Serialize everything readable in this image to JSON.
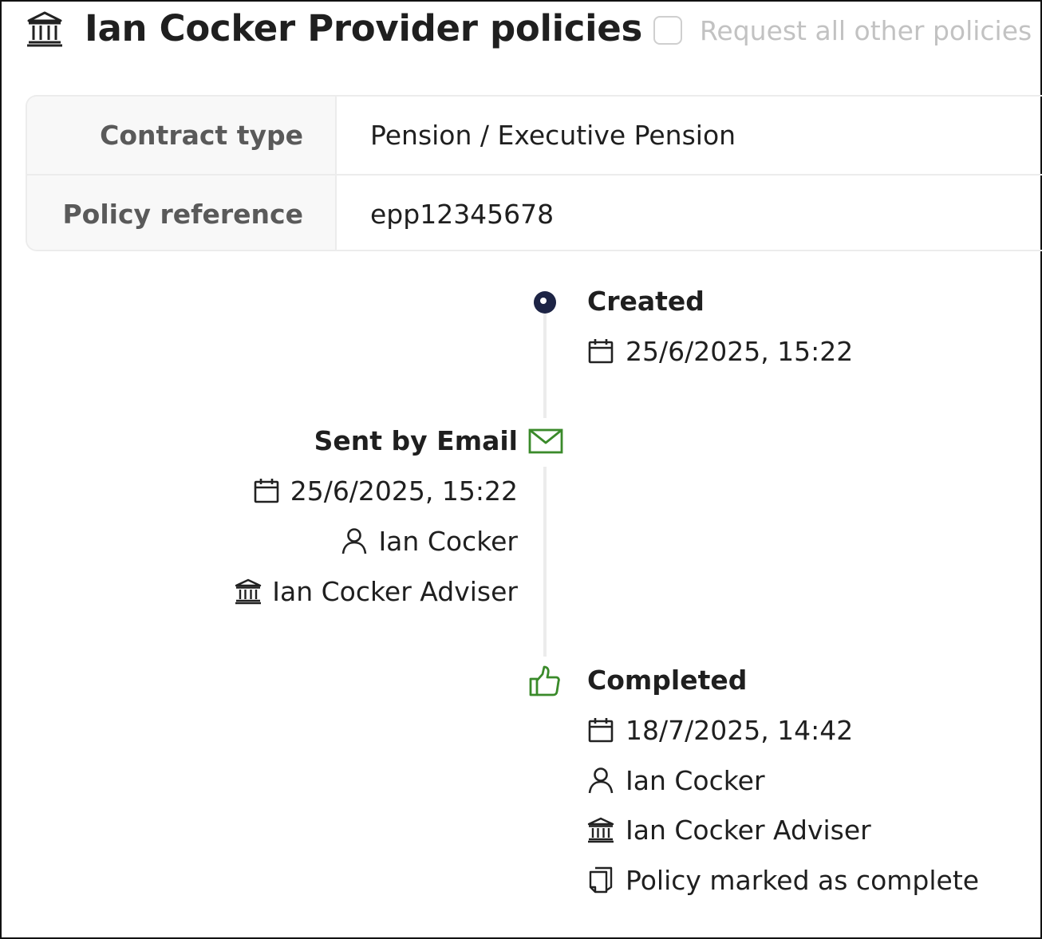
{
  "header": {
    "title": "Ian Cocker Provider policies",
    "request_all_label": "Request all other policies",
    "request_all_checked": false
  },
  "details": [
    {
      "label": "Contract type",
      "value": "Pension / Executive Pension"
    },
    {
      "label": "Policy reference",
      "value": "epp12345678"
    }
  ],
  "timeline": {
    "created": {
      "title": "Created",
      "date": "25/6/2025, 15:22"
    },
    "sent": {
      "title": "Sent by Email",
      "date": "25/6/2025, 15:22",
      "user": "Ian Cocker",
      "organisation": "Ian Cocker Adviser"
    },
    "completed": {
      "title": "Completed",
      "date": "18/7/2025, 14:42",
      "user": "Ian Cocker",
      "organisation": "Ian Cocker Adviser",
      "note": "Policy marked as complete"
    }
  },
  "colors": {
    "accent_green": "#3a8a2a",
    "marker_navy": "#1d2445",
    "line_grey": "#ececec"
  },
  "icons": {
    "title": "bank-icon",
    "created": "circle-dot-icon",
    "sent": "envelope-icon",
    "completed": "thumbs-up-icon",
    "date": "calendar-icon",
    "user": "user-icon",
    "organisation": "bank-icon",
    "note": "document-icon"
  }
}
